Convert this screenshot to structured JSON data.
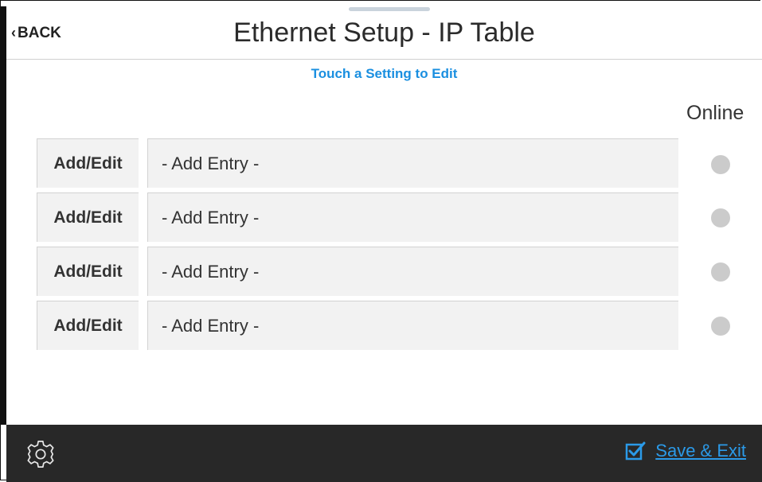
{
  "header": {
    "back_label": "BACK",
    "title": "Ethernet Setup - IP Table"
  },
  "hint": "Touch a Setting to Edit",
  "table": {
    "online_header": "Online",
    "rows": [
      {
        "action_label": "Add/Edit",
        "entry": "- Add Entry -",
        "online": false
      },
      {
        "action_label": "Add/Edit",
        "entry": "- Add Entry -",
        "online": false
      },
      {
        "action_label": "Add/Edit",
        "entry": "- Add Entry -",
        "online": false
      },
      {
        "action_label": "Add/Edit",
        "entry": "- Add Entry -",
        "online": false
      }
    ]
  },
  "footer": {
    "settings_icon": "gear-icon",
    "save_icon": "checkbox-checked-icon",
    "save_label": "Save & Exit"
  },
  "colors": {
    "accent": "#1a8fe0",
    "footer_bg": "#282828",
    "status_offline": "#cbcbcb"
  }
}
